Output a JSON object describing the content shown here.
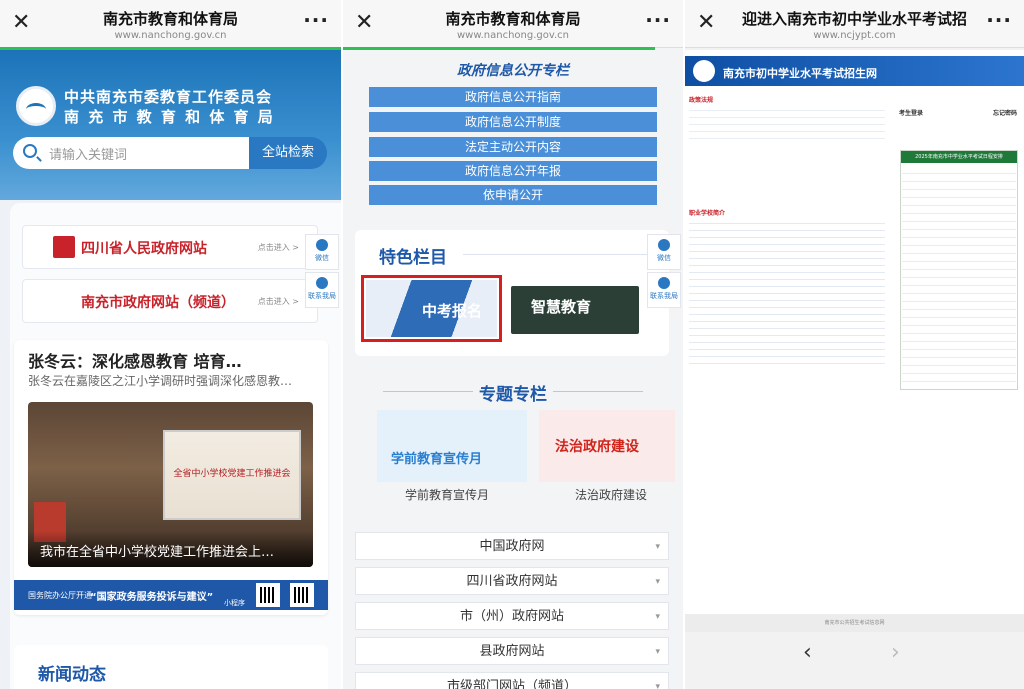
{
  "panel1": {
    "title": "南充市教育和体育局",
    "url": "www.nanchong.gov.cn",
    "org_line1": "中共南充市委教育工作委员会",
    "org_line2": "南 充 市 教 育 和 体 育 局",
    "search_placeholder": "请输入关键词",
    "search_button": "全站检索",
    "link1": "四川省人民政府网站",
    "link2": "南充市政府网站（频道）",
    "link_go": "点击进入 >",
    "side_wechat": "微信",
    "side_contact": "联系我局",
    "news_headline": "张冬云：深化感恩教育 培育…",
    "news_sub": "张冬云在嘉陵区之江小学调研时强调深化感恩教…",
    "photo_screen": "全省中小学校党建工作推进会",
    "photo_caption": "我市在全省中小学校党建工作推进会上…",
    "ad_small": "国务院办公厅开通",
    "ad_main": "“国家政务服务投诉与建议”",
    "ad_mini": "小程序",
    "news_section": "新闻动态"
  },
  "panel2": {
    "title": "南充市教育和体育局",
    "url": "www.nanchong.gov.cn",
    "section": "政府信息公开专栏",
    "buttons": [
      "政府信息公开指南",
      "政府信息公开制度",
      "法定主动公开内容",
      "政府信息公开年报",
      "依申请公开"
    ],
    "feature_title": "特色栏目",
    "exam_label": "中考报名",
    "wisdom_label": "智慧教育",
    "side_wechat": "微信",
    "side_contact": "联系我局",
    "topic_title": "专题专栏",
    "topic1_banner": "学前教育宣传月",
    "topic2_banner": "法治政府建设",
    "topic1_label": "学前教育宣传月",
    "topic2_label": "法治政府建设",
    "selects": [
      "中国政府网",
      "四川省政府网站",
      "市（州）政府网站",
      "县政府网站",
      "市级部门网站（频道）"
    ]
  },
  "panel3": {
    "title": "迎进入南充市初中学业水平考试招",
    "url": "www.ncjypt.com",
    "banner": "南充市初中学业水平考试招生网",
    "notice_head": "政策法规",
    "school_head": "职业学校简介",
    "login": "考生登录",
    "login_right": "忘记密码",
    "side_head": "2025年南充市中学业水平考试日程安排",
    "footer": "南充市公共招生考试信息网"
  }
}
